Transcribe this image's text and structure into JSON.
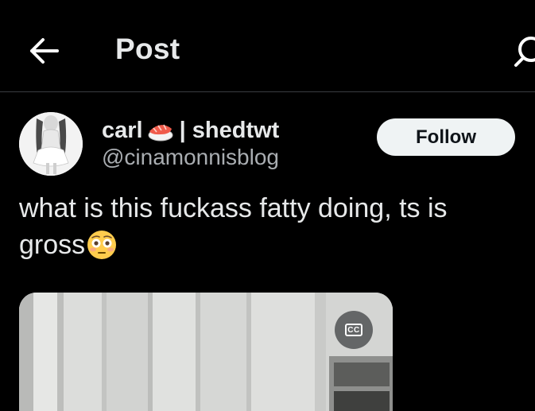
{
  "header": {
    "back_icon": "arrow-left-icon",
    "title": "Post",
    "search_icon": "search-icon"
  },
  "post": {
    "author": {
      "display_name": "carl",
      "name_emoji": "sushi-emoji",
      "name_suffix": "| shedtwt",
      "handle": "@cinamonnisblog"
    },
    "follow_label": "Follow",
    "text_line1": "what is this fuckass fatty doing, ts is",
    "text_line2": "gross",
    "text_emoji": "flushed-face-emoji",
    "media": {
      "cc_label": "CC"
    }
  },
  "colors": {
    "background": "#000000",
    "text_primary": "#e7e9ea",
    "text_secondary": "#a9adb1",
    "follow_bg": "#eff3f4",
    "divider": "#3a3d41"
  }
}
